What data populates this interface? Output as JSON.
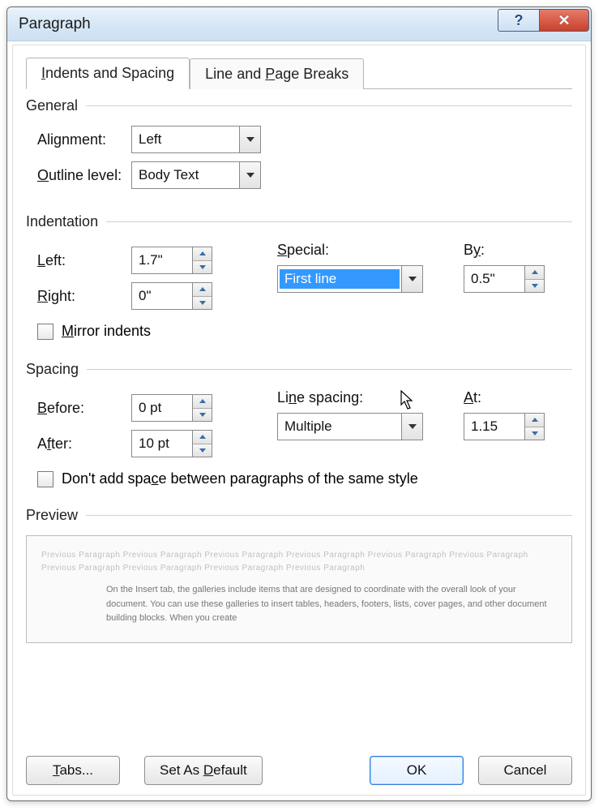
{
  "title": "Paragraph",
  "tabs": {
    "indents": "Indents and Spacing",
    "breaks": "Line and Page Breaks",
    "breaks_underline_char": "P"
  },
  "general": {
    "header": "General",
    "alignment_label": "Alignment:",
    "alignment_value": "Left",
    "outline_label": "Outline level:",
    "outline_underline_char": "O",
    "outline_value": "Body Text"
  },
  "indentation": {
    "header": "Indentation",
    "left_label": "Left:",
    "left_underline_char": "L",
    "left_value": "1.7\"",
    "right_label": "Right:",
    "right_underline_char": "R",
    "right_value": "0\"",
    "special_label": "Special:",
    "special_underline_char": "S",
    "special_value": "First line",
    "by_label": "By:",
    "by_underline_char": "y",
    "by_value": "0.5\"",
    "mirror_label": "Mirror indents",
    "mirror_underline_char": "M",
    "mirror_checked": false
  },
  "spacing": {
    "header": "Spacing",
    "before_label": "Before:",
    "before_underline_char": "B",
    "before_value": "0 pt",
    "after_label": "After:",
    "after_underline_char": "f",
    "after_value": "10 pt",
    "line_label": "Line spacing:",
    "line_underline_char": "N",
    "line_value": "Multiple",
    "at_label": "At:",
    "at_underline_char": "A",
    "at_value": "1.15",
    "dont_add_label": "Don't add space between paragraphs of the same style",
    "dont_add_checked": false
  },
  "preview": {
    "header": "Preview",
    "ghost_text": "Previous Paragraph Previous Paragraph Previous Paragraph Previous Paragraph Previous Paragraph Previous Paragraph Previous Paragraph Previous Paragraph Previous Paragraph Previous Paragraph",
    "sample_text": "On the Insert tab, the galleries include items that are designed to coordinate with the overall look of your document. You can use these galleries to insert tables, headers, footers, lists, cover pages, and other document building blocks. When you create"
  },
  "buttons": {
    "tabs": "Tabs...",
    "tabs_underline_char": "T",
    "default": "Set As Default",
    "default_underline_char": "D",
    "ok": "OK",
    "cancel": "Cancel"
  }
}
